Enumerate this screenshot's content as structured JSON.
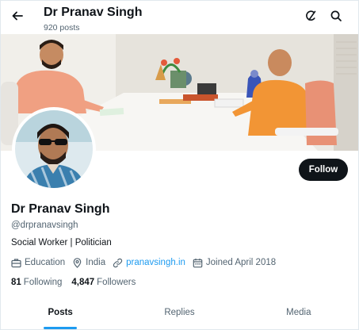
{
  "header": {
    "title": "Dr Pranav Singh",
    "post_count": "920 posts"
  },
  "profile": {
    "name": "Dr Pranav Singh",
    "handle": "@drpranavsingh",
    "bio": "Social Worker | Politician",
    "category": "Education",
    "location": "India",
    "website": "pranavsingh.in",
    "joined": "Joined April 2018",
    "follow_label": "Follow"
  },
  "stats": {
    "following_count": "81",
    "following_label": "Following",
    "followers_count": "4,847",
    "followers_label": "Followers"
  },
  "tabs": [
    {
      "label": "Posts",
      "active": true
    },
    {
      "label": "Replies",
      "active": false
    },
    {
      "label": "Media",
      "active": false
    }
  ],
  "colors": {
    "accent": "#1d9bf0",
    "text": "#0f1419",
    "secondary": "#536471",
    "follow_button": "#0f1419"
  },
  "icons": [
    "back-arrow-icon",
    "grok-icon",
    "search-icon",
    "briefcase-icon",
    "location-pin-icon",
    "link-icon",
    "calendar-icon"
  ]
}
